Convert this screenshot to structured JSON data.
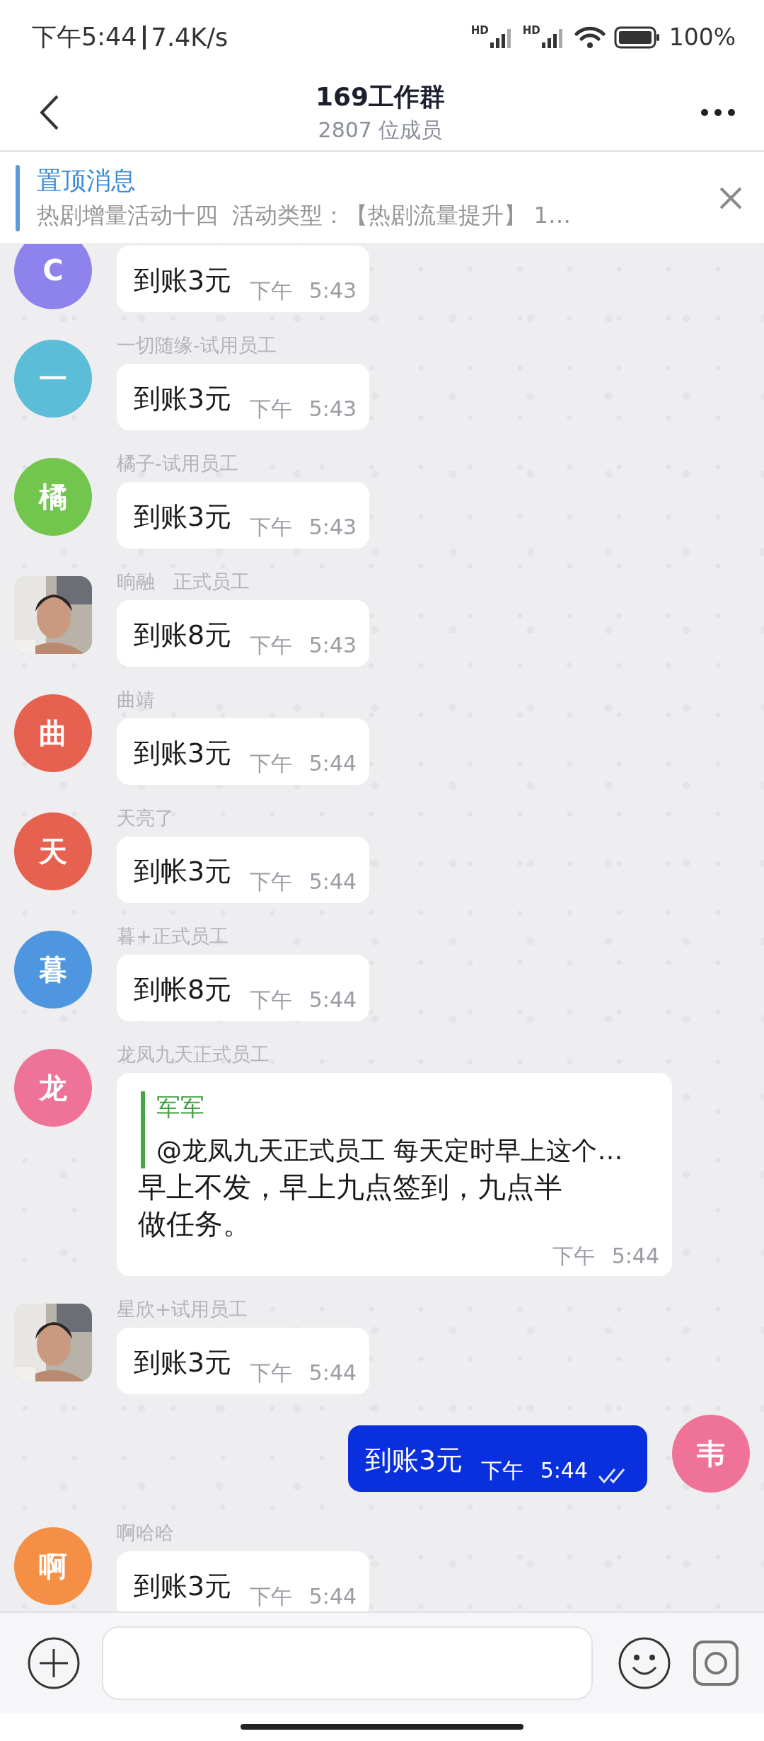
{
  "status_bar": {
    "time": "下午5:44",
    "speed": "7.4K/s",
    "signals": [
      {
        "label": "HD"
      },
      {
        "label": "HD"
      }
    ],
    "battery": "100%"
  },
  "header": {
    "title": "169工作群",
    "subtitle": "2807 位成员"
  },
  "pinned": {
    "title": "置顶消息",
    "text": "热剧增量活动十四  活动类型：【热剧流量提升】 1…"
  },
  "messages": [
    {
      "kind": "incoming",
      "avatar": {
        "kind": "letter",
        "letter": "C",
        "color": "#8e83ec"
      },
      "text": "到账3元",
      "time": "下午 5:43"
    },
    {
      "kind": "incoming",
      "sender": "一切随缘-试用员工",
      "avatar": {
        "kind": "letter",
        "letter": "一",
        "color": "#5bbdd7"
      },
      "text": "到账3元",
      "time": "下午 5:43"
    },
    {
      "kind": "incoming",
      "sender": "橘子-试用员工",
      "avatar": {
        "kind": "letter",
        "letter": "橘",
        "color": "#72c54d"
      },
      "text": "到账3元",
      "time": "下午 5:43"
    },
    {
      "kind": "incoming",
      "sender": "晌融   正式员工",
      "text": "到账8元",
      "time": "下午 5:43"
    },
    {
      "kind": "incoming",
      "sender": "曲靖",
      "avatar": {
        "kind": "letter",
        "letter": "曲",
        "color": "#e6614f"
      },
      "text": "到账3元",
      "time": "下午 5:44"
    },
    {
      "kind": "incoming",
      "sender": "天亮了",
      "avatar": {
        "kind": "letter",
        "letter": "天",
        "color": "#e6614f"
      },
      "text": "到帐3元",
      "time": "下午 5:44"
    },
    {
      "kind": "incoming",
      "sender": "暮+正式员工",
      "avatar": {
        "kind": "letter",
        "letter": "暮",
        "color": "#4f96e0"
      },
      "text": "到帐8元",
      "time": "下午 5:44"
    },
    {
      "kind": "quote",
      "sender": "龙凤九天正式员工",
      "avatar": {
        "kind": "letter",
        "letter": "龙",
        "color": "#ef7399"
      },
      "quote": {
        "author": "军军",
        "text": "@龙凤九天正式员工 每天定时早上这个…"
      },
      "text": "早上不发，早上九点签到，九点半做任务。",
      "time": "下午 5:44"
    },
    {
      "kind": "incoming",
      "sender": "星欣+试用员工",
      "text": "到账3元",
      "time": "下午 5:44"
    },
    {
      "kind": "outgoing",
      "avatar": {
        "kind": "letter",
        "letter": "韦",
        "color": "#ef7399"
      },
      "text": "到账3元",
      "time": "下午 5:44",
      "read": true
    },
    {
      "kind": "incoming",
      "sender": "啊哈哈",
      "avatar": {
        "kind": "letter",
        "letter": "啊",
        "color": "#f58f45"
      },
      "text": "到账3元",
      "time": "下午 5:44"
    }
  ]
}
